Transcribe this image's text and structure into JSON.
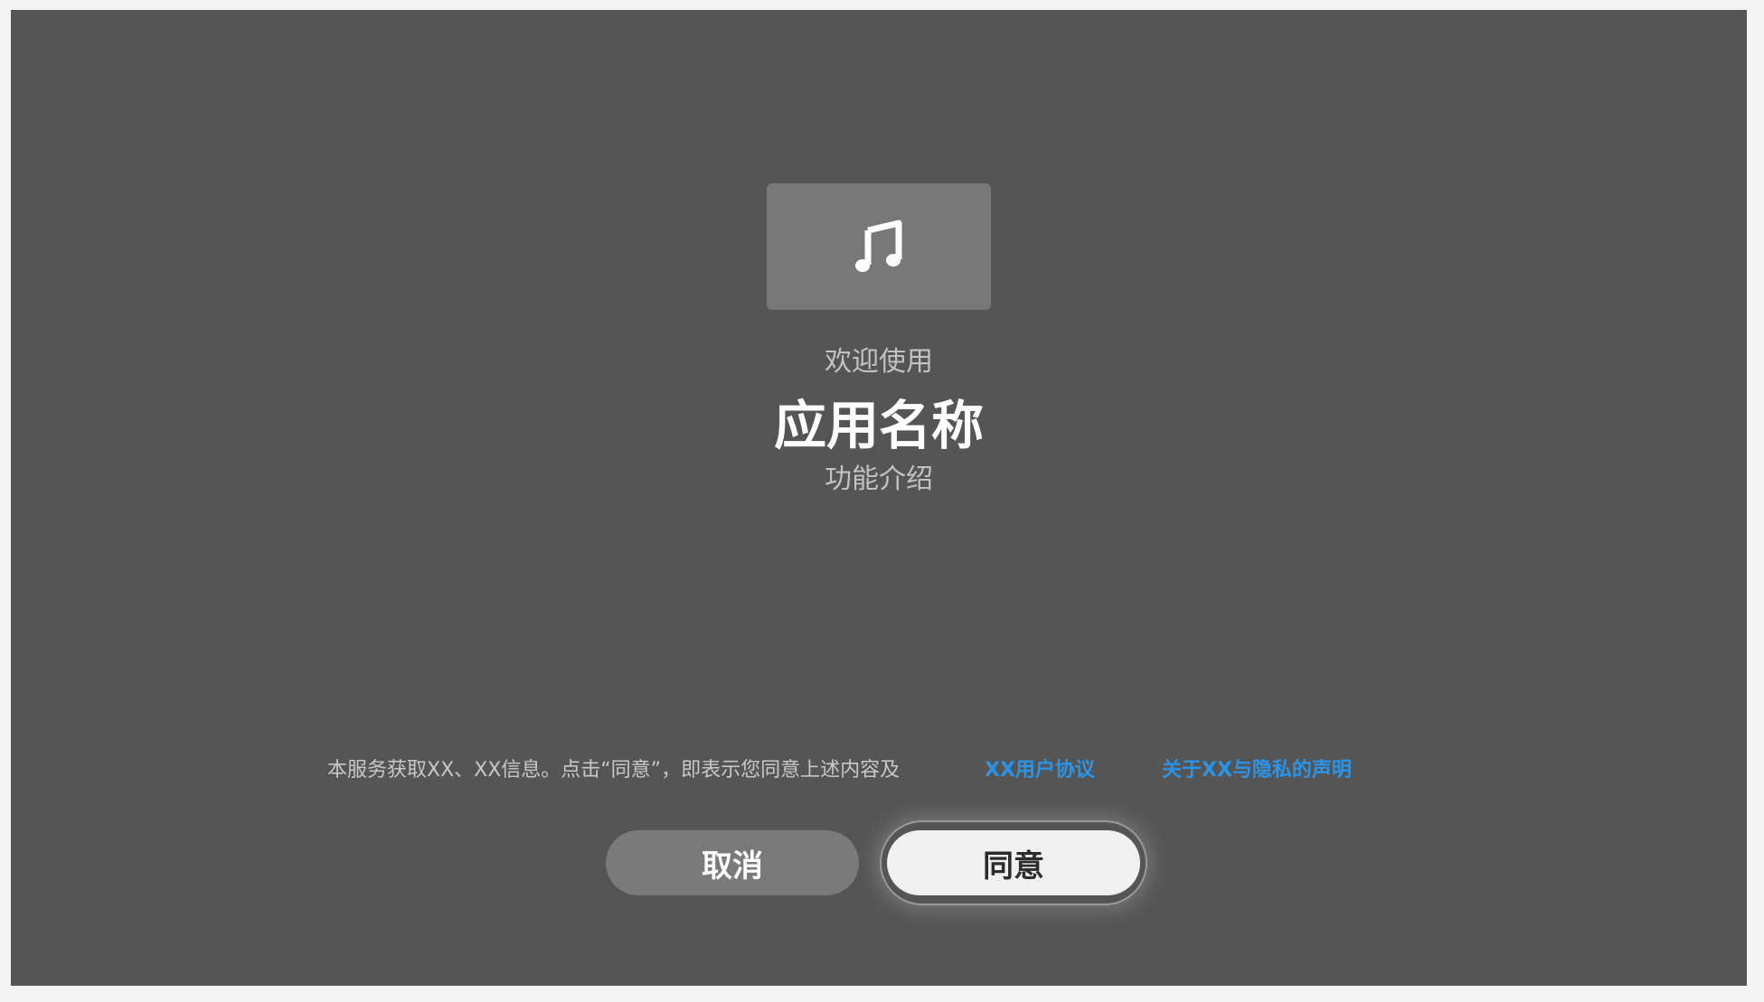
{
  "app_icon": {
    "icon": "music-note-icon"
  },
  "welcome_text": "欢迎使用",
  "app_name": "应用名称",
  "feature_intro": "功能介绍",
  "notice": {
    "text": "本服务获取XX、XX信息。点击“同意”，即表示您同意上述内容及",
    "links": {
      "user_agreement": "XX用户协议",
      "privacy_statement": "关于XX与隐私的声明"
    }
  },
  "buttons": {
    "cancel": "取消",
    "agree": "同意"
  },
  "colors": {
    "background": "#555555",
    "link": "#2a94e8",
    "agree_button": "#f0f0f0",
    "cancel_button": "#7a7a7a"
  }
}
